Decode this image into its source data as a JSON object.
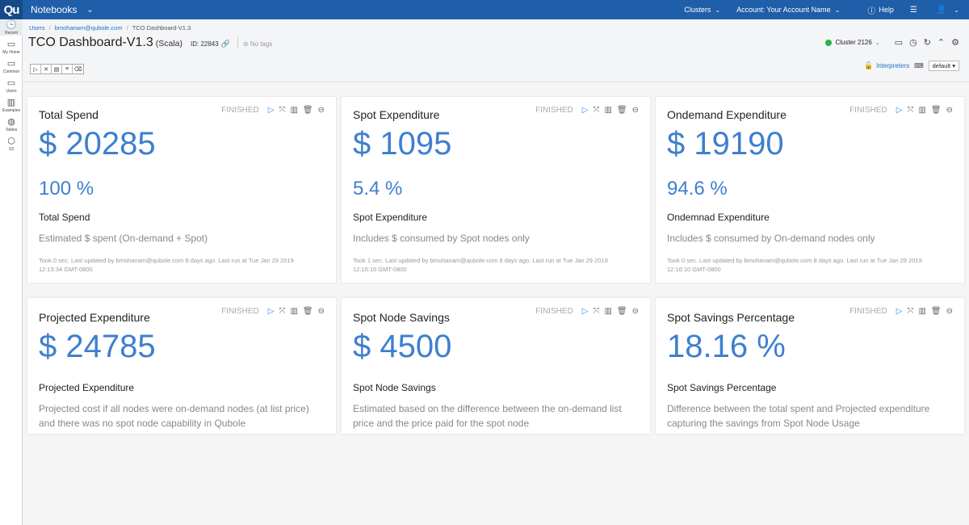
{
  "topbar": {
    "logo": "Qu",
    "menu_label": "Notebooks",
    "clusters_label": "Clusters",
    "account_label": "Account: Your Account Name",
    "help_label": "Help"
  },
  "rail": [
    {
      "label": "Recent",
      "icon": "clock-icon"
    },
    {
      "label": "My Home",
      "icon": "folder-icon"
    },
    {
      "label": "Common",
      "icon": "folder-icon"
    },
    {
      "label": "Users",
      "icon": "folder-icon"
    },
    {
      "label": "Examples",
      "icon": "book-icon"
    },
    {
      "label": "Tables",
      "icon": "database-icon"
    },
    {
      "label": "S3",
      "icon": "cube-icon"
    }
  ],
  "breadcrumb": [
    "Users",
    "bmohanam@qubole.com",
    "TCO Dashboard-V1.3"
  ],
  "notebook": {
    "title": "TCO Dashboard-V1.3",
    "lang": "(Scala)",
    "id": "ID: 22843",
    "tags": "No tags",
    "cluster": "Cluster 2126",
    "interpreters_label": "Interpreters",
    "interpreter_value": "default"
  },
  "status_color": "#2ab24a",
  "accent_color": "#3e7fcf",
  "cards": [
    {
      "title": "Total Spend",
      "status": "FINISHED",
      "value": "$ 20285",
      "pct": "100 %",
      "label": "Total Spend",
      "desc": "Estimated $ spent (On-demand + Spot)",
      "meta": "Took 0 sec. Last updated by bmohanam@qubole.com 8 days ago. Last run at Tue Jan 29 2019 12:15:34 GMT-0800"
    },
    {
      "title": "Spot Expenditure",
      "status": "FINISHED",
      "value": "$ 1095",
      "pct": "5.4 %",
      "label": "Spot Expenditure",
      "desc": "Includes $ consumed by Spot nodes only",
      "meta": "Took 1 sec. Last updated by bmohanam@qubole.com 8 days ago. Last run at Tue Jan 29 2019 12:16:10 GMT-0800"
    },
    {
      "title": "Ondemand Expenditure",
      "status": "FINISHED",
      "value": "$ 19190",
      "pct": "94.6 %",
      "label": "Ondemnad Expenditure",
      "desc": "Includes $ consumed by On-demand nodes only",
      "meta": "Took 0 sec. Last updated by bmohanam@qubole.com 8 days ago. Last run at Tue Jan 29 2019 12:16:10 GMT-0800"
    },
    {
      "title": "Projected Expenditure",
      "status": "FINISHED",
      "value": "$ 24785",
      "label": "Projected Expenditure",
      "desc": "Projected cost if all nodes were on-demand nodes (at list price) and there was no spot node capability in Qubole"
    },
    {
      "title": "Spot Node Savings",
      "status": "FINISHED",
      "value": "$ 4500",
      "label": "Spot Node Savings",
      "desc": "Estimated based on the difference between the on-demand list price and the price paid for the spot node"
    },
    {
      "title": "Spot Savings Percentage",
      "status": "FINISHED",
      "value": "18.16 %",
      "label": "Spot Savings Percentage",
      "desc": "Difference between the total spent and Projected expenditure capturing the savings from Spot Node Usage"
    }
  ]
}
